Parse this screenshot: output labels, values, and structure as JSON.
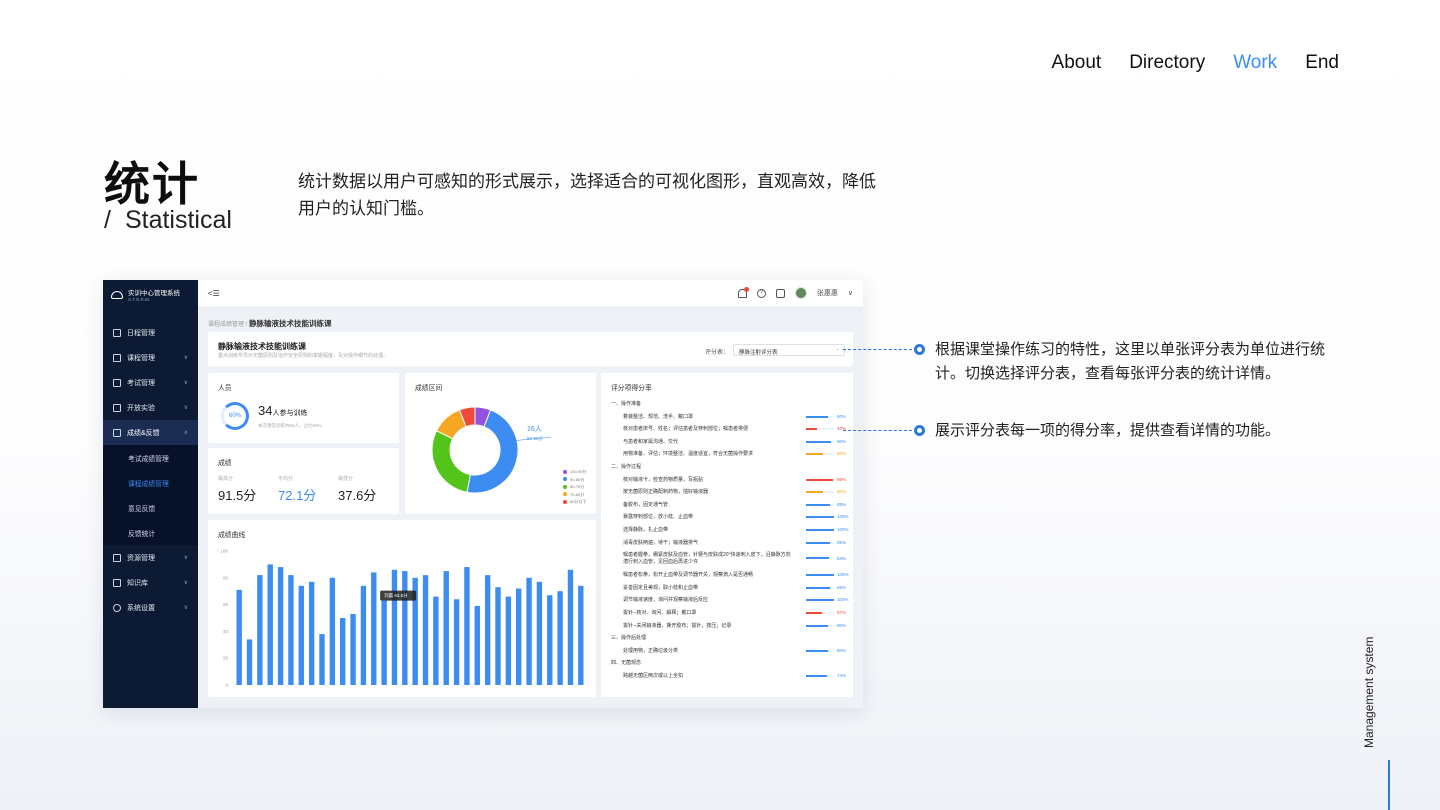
{
  "nav": {
    "items": [
      "About",
      "Directory",
      "Work",
      "End"
    ],
    "active": "Work"
  },
  "heading": {
    "cn": "统计",
    "slash": "/",
    "en": "Statistical"
  },
  "description": "统计数据以用户可感知的形式展示，选择适合的可视化图形，直观高效，降低用户的认知门槛。",
  "app": {
    "brand": {
      "name": "实训中心管理系统",
      "sub": "S.T.O.R.M."
    },
    "menu": [
      {
        "label": "日程管理",
        "chevron": ""
      },
      {
        "label": "课程管理",
        "chevron": "∨"
      },
      {
        "label": "考试管理",
        "chevron": "∨"
      },
      {
        "label": "开放实验",
        "chevron": "∨"
      },
      {
        "label": "成绩&反馈",
        "chevron": "∧"
      }
    ],
    "submenu": [
      "考试成绩管理",
      "课程成绩管理",
      "意见反馈",
      "反馈统计"
    ],
    "submenu_active": "课程成绩管理",
    "menu2": [
      {
        "label": "资源管理",
        "chevron": "∨"
      },
      {
        "label": "知识库",
        "chevron": "∨"
      },
      {
        "label": "系统设置",
        "chevron": "∨"
      }
    ],
    "topbar": {
      "fold": "<☰",
      "help": "?",
      "user": "张惠惠"
    },
    "breadcrumb": {
      "parent": "课程成绩管理 /",
      "current": "静脉输液技术技能训练课"
    },
    "course": {
      "title": "静脉输液技术技能训练课",
      "subtitle": "重点训练学员对无菌原则及治疗安全原则的掌握程度，及对操作细节的处理。",
      "select_label": "评分表：",
      "select_value": "静脉注射评分表"
    },
    "people": {
      "title": "人员",
      "pct": "60%",
      "count": "34",
      "unit": "人参与训练",
      "note": "本次课堂训练共50人，占比60%"
    },
    "score": {
      "title": "成绩",
      "max_label": "最高分",
      "max": "91.5分",
      "avg_label": "平均分",
      "avg": "72.1分",
      "min_label": "最低分",
      "min": "37.6分"
    },
    "range": {
      "title": "成绩区间",
      "callout": "16人",
      "callout_sub": "90-80分",
      "legend": [
        "100-90分",
        "90-80分",
        "80-70分",
        "70-60分",
        "60分以下"
      ]
    },
    "curve": {
      "title": "成绩曲线",
      "tooltip": "刘晨 63.6分"
    },
    "rates": {
      "title": "评分项得分率"
    }
  },
  "callouts": [
    "根据课堂操作练习的特性，这里以单张评分表为单位进行统计。切换选择评分表，查看每张评分表的统计详情。",
    "展示评分表每一项的得分率，提供查看详情的功能。"
  ],
  "side_label": "Management system",
  "colors": {
    "accent": "#3d8cf2",
    "sidebar": "#0c1a33",
    "red": "#f04a3a",
    "orange": "#f5a623",
    "green": "#52c41a",
    "purple": "#9254de"
  },
  "chart_data": [
    {
      "type": "pie",
      "title": "成绩区间",
      "categories": [
        "100-90分",
        "90-80分",
        "80-70分",
        "70-60分",
        "60分以下"
      ],
      "values": [
        2,
        16,
        10,
        4,
        2
      ]
    },
    {
      "type": "bar",
      "title": "成绩曲线",
      "ylim": [
        0,
        100
      ],
      "yticks": [
        0,
        20,
        40,
        60,
        80,
        100
      ],
      "values": [
        71,
        34,
        82,
        90,
        88,
        82,
        74,
        77,
        38,
        80,
        50,
        53,
        74,
        84,
        63,
        86,
        85,
        80,
        82,
        66,
        85,
        64,
        88,
        59,
        82,
        73,
        66,
        72,
        80,
        77,
        67,
        70,
        86,
        74
      ]
    },
    {
      "type": "table",
      "title": "评分项得分率",
      "rows": [
        {
          "text": "一、操作准备",
          "section": true
        },
        {
          "text": "着装整洁、规范、洗手、戴口罩",
          "pct": "80%",
          "value": 80,
          "color": "#3d8cf2"
        },
        {
          "text": "核对患者床号、姓名；评估患者及穿刺部位；嘱患者排便",
          "pct": "40%",
          "value": 40,
          "color": "#f04a3a"
        },
        {
          "text": "与患者和家属沟通、交代",
          "pct": "90%",
          "value": 90,
          "color": "#3d8cf2"
        },
        {
          "text": "用物准备、评估；环境整洁、温度适宜，符合无菌操作要求",
          "pct": "60%",
          "value": 60,
          "color": "#f5a623"
        },
        {
          "text": "二、操作过程",
          "section": true
        },
        {
          "text": "核对输液卡，检查药物质量，写瓶贴",
          "pct": "98%",
          "value": 98,
          "color": "#f04a3a"
        },
        {
          "text": "按无菌原则正确配制药物，插好输液器",
          "pct": "60%",
          "value": 60,
          "color": "#f5a623"
        },
        {
          "text": "备胶布，固定通气管",
          "pct": "85%",
          "value": 85,
          "color": "#3d8cf2"
        },
        {
          "text": "暴露穿刺部位，放小枕、止血带",
          "pct": "100%",
          "value": 100,
          "color": "#3d8cf2"
        },
        {
          "text": "选择静脉，扎止血带",
          "pct": "100%",
          "value": 100,
          "color": "#3d8cf2"
        },
        {
          "text": "消毒皮肤两遍，待干；输液器排气",
          "pct": "85%",
          "value": 85,
          "color": "#3d8cf2"
        },
        {
          "text": "嘱患者握拳，绷紧皮肤及血管，针梗与皮肤成20°快速刺入皮下，沿静脉方向潜行刺入血管，见回血后再进少许",
          "pct": "83%",
          "value": 83,
          "color": "#3d8cf2",
          "tall": true
        },
        {
          "text": "嘱患者松拳，松开止血带及调节器开关，观察滴入是否通畅",
          "pct": "100%",
          "value": 100,
          "color": "#3d8cf2"
        },
        {
          "text": "妥善固定且美观；取小枕和止血带",
          "pct": "86%",
          "value": 86,
          "color": "#3d8cf2"
        },
        {
          "text": "调节输液速度，询问并观察输液后反应",
          "pct": "100%",
          "value": 100,
          "color": "#3d8cf2"
        },
        {
          "text": "拔针--核对、询问、解释；戴口罩",
          "pct": "57%",
          "value": 57,
          "color": "#f04a3a"
        },
        {
          "text": "拔针--关闭输液器，撕开胶布；拔针，按压；记录",
          "pct": "80%",
          "value": 80,
          "color": "#3d8cf2"
        },
        {
          "text": "三、操作后处理",
          "section": true
        },
        {
          "text": "处理用物，正确垃圾分类",
          "pct": "80%",
          "value": 80,
          "color": "#3d8cf2"
        },
        {
          "text": "四、无菌观念",
          "section": true
        },
        {
          "text": "跨越无菌区两次或以上全扣",
          "pct": "74%",
          "value": 74,
          "color": "#3d8cf2"
        }
      ]
    }
  ]
}
